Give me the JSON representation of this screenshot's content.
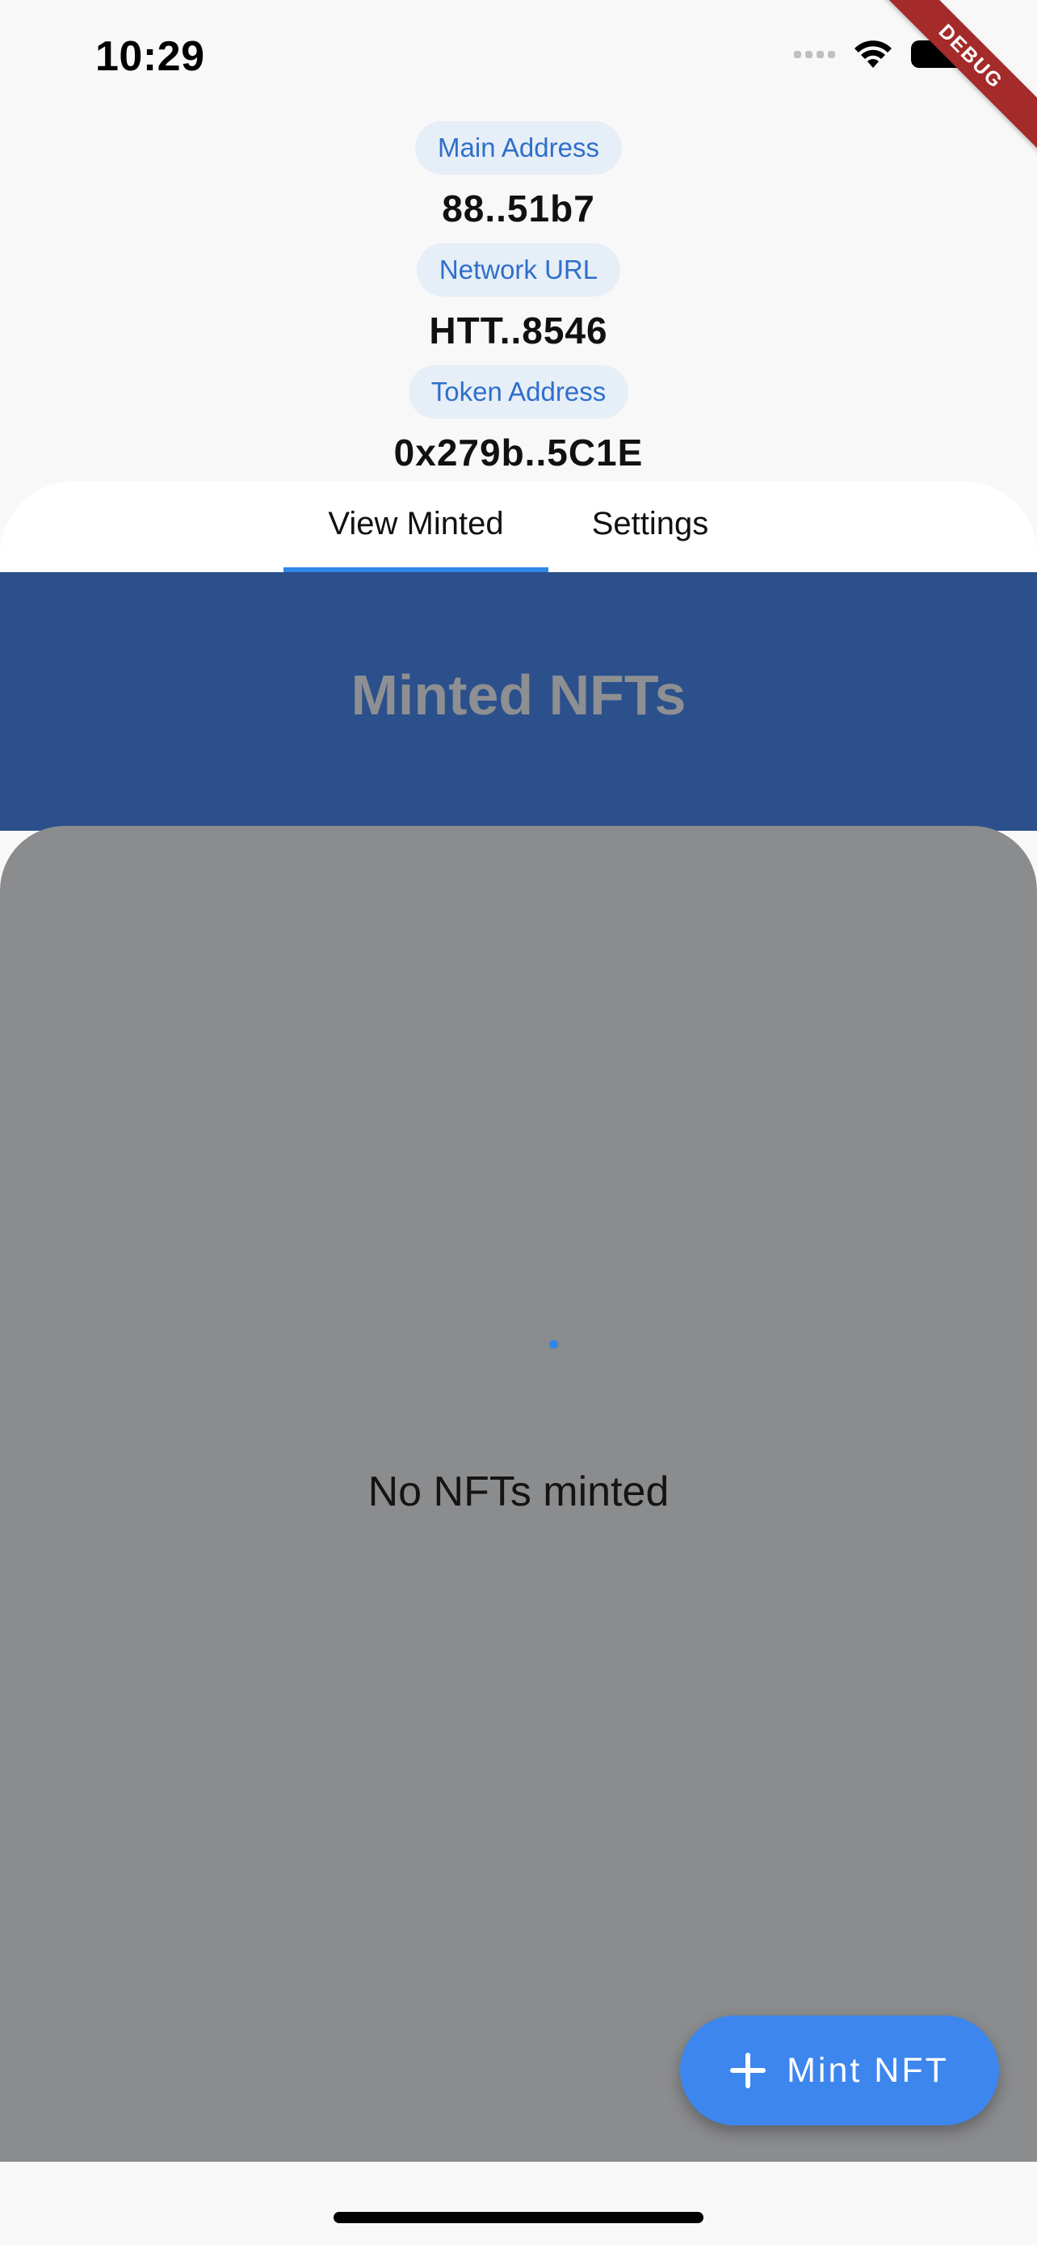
{
  "status_bar": {
    "time": "10:29"
  },
  "debug_banner": "DEBUG",
  "info": {
    "main_address_label": "Main Address",
    "main_address_value": "88..51b7",
    "network_url_label": "Network URL",
    "network_url_value": "HTT..8546",
    "token_address_label": "Token Address",
    "token_address_value": "0x279b..5C1E"
  },
  "tabs": [
    {
      "label": "View Minted",
      "selected": true
    },
    {
      "label": "Settings",
      "selected": false
    }
  ],
  "section_title": "Minted NFTs",
  "empty_state": "No NFTs minted",
  "fab": {
    "label": "Mint NFT",
    "icon": "plus-icon"
  },
  "colors": {
    "accent": "#2f88e8",
    "header_blue": "#2b508b",
    "body_gray": "#8b8c8e",
    "fab_blue": "#3d86ee",
    "chip_text": "#2f6fca"
  }
}
